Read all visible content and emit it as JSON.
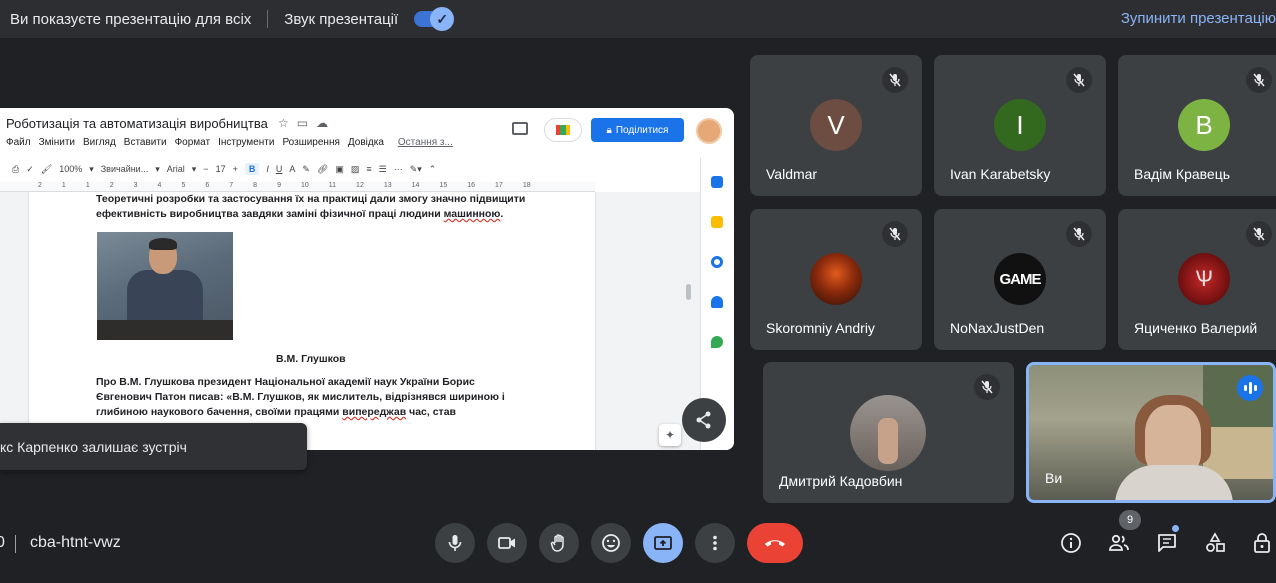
{
  "topbar": {
    "presenting_msg": "Ви показуєте презентацію для всіх",
    "sound_label": "Звук презентації",
    "stop_label": "Зупинити презентацію"
  },
  "doc": {
    "title": "Роботизація та автоматизація виробництва",
    "menu": [
      "Файл",
      "Змінити",
      "Вигляд",
      "Вставити",
      "Формат",
      "Інструменти",
      "Розширення",
      "Довідка"
    ],
    "last_edit": "Остання з...",
    "share_label": "Поділитися",
    "toolbar": {
      "zoom": "100%",
      "style": "Звичайни...",
      "font": "Arial",
      "size": "17"
    },
    "ruler": [
      "2",
      "1",
      "1",
      "2",
      "3",
      "4",
      "5",
      "6",
      "7",
      "8",
      "9",
      "10",
      "11",
      "12",
      "13",
      "14",
      "15",
      "16",
      "17",
      "18"
    ],
    "para1_a": "Теоретичні розробки та застосування їх на практиці дали змогу значно підвищити ефективність виробництва завдяки заміні фізичної праці людини ",
    "para1_b": "машинною",
    "para1_c": ".",
    "caption": "В.М. Глушков",
    "para2_a": "Про В.М. Глушкова президент Національної академії наук України Борис Євгенович Патон писав: «В.М. Глушков, як мислитель, відрізнявся шириною і глибиною наукового бачення, своїми працями ",
    "para2_b": "випереджав",
    "para2_c": " час, став"
  },
  "toast": "кс Карпенко залишає зустріч",
  "participants": [
    {
      "name": "Valdmar",
      "initial": "V",
      "color": "#6d4c41"
    },
    {
      "name": "Ivan Karabetsky",
      "initial": "I",
      "color": "#33691e"
    },
    {
      "name": "Вадім Кравець",
      "initial": "В",
      "color": "#7cb342"
    },
    {
      "name": "Skoromniy Andriy",
      "initial": "",
      "color": "#5a1e0e"
    },
    {
      "name": "NoNaxJustDen",
      "initial": "GAME",
      "color": "#111111"
    },
    {
      "name": "Яциченко Валерий",
      "initial": "",
      "color": "#8b1a1a"
    },
    {
      "name": "Дмитрий Кадовбин",
      "initial": "",
      "color": "#7d7a78"
    },
    {
      "name": "Ви",
      "initial": "",
      "color": "#6b6a5e"
    }
  ],
  "bottom": {
    "zero": "0",
    "meeting_code": "cba-htnt-vwz",
    "people_count": "9"
  },
  "colors": {
    "accent": "#8ab4f8",
    "end_call": "#ea4335",
    "tile_bg": "#3c4043"
  }
}
